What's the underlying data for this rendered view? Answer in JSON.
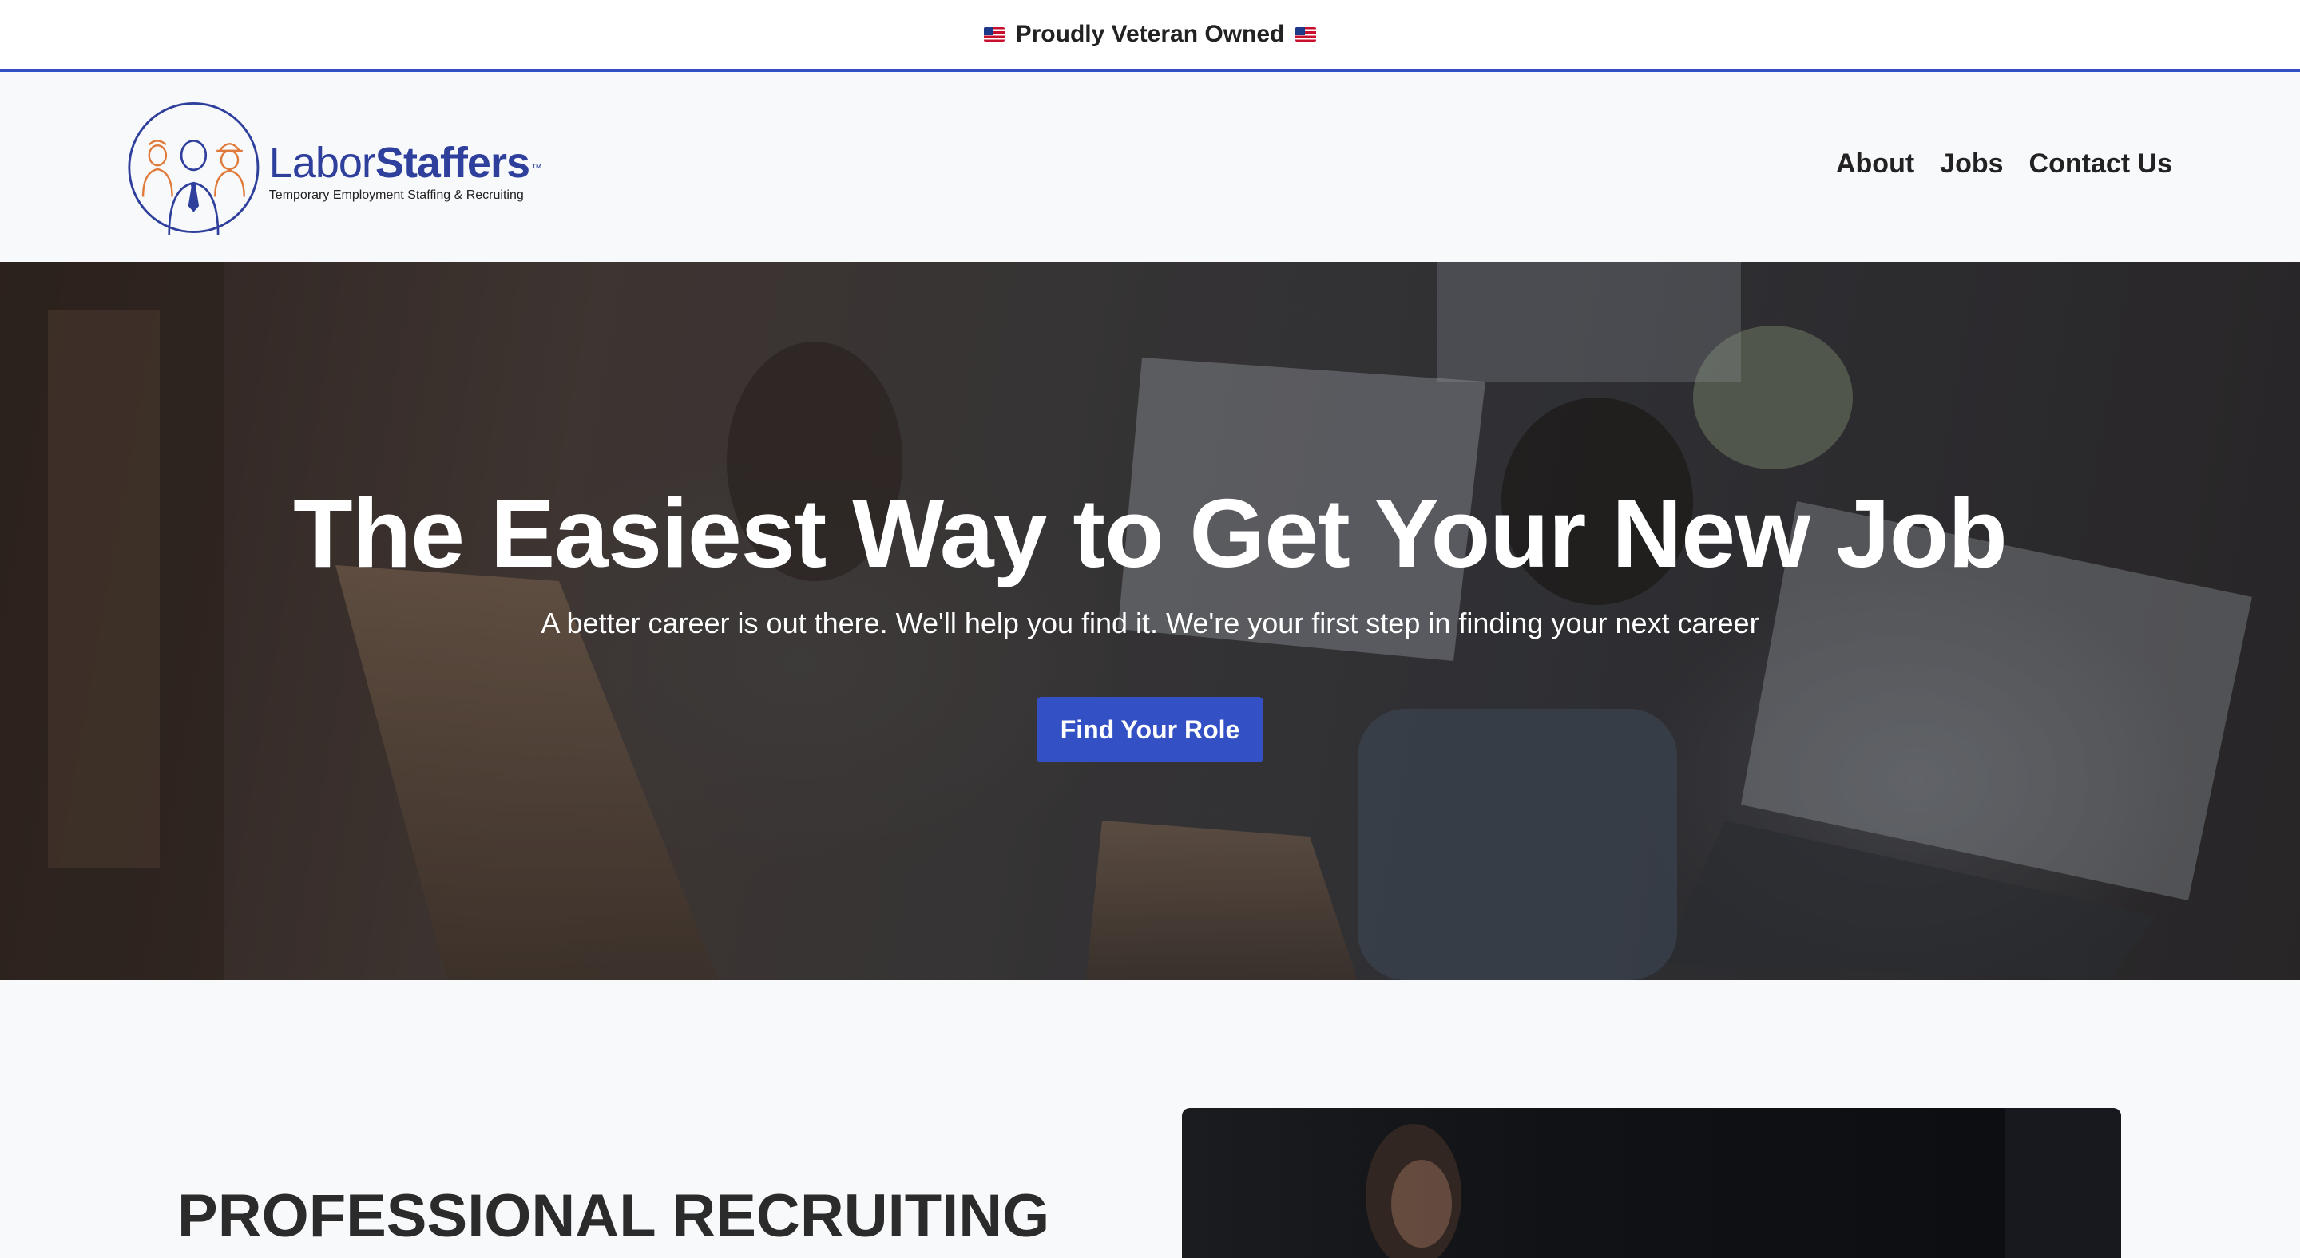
{
  "announcement": {
    "text": "Proudly Veteran Owned",
    "left_icon": "us-flag-icon",
    "right_icon": "us-flag-icon"
  },
  "header": {
    "brand": {
      "word1": "Labor",
      "word2": "Staffers",
      "trademark": "™",
      "tagline": "Temporary Employment Staffing & Recruiting"
    },
    "nav": [
      {
        "label": "About"
      },
      {
        "label": "Jobs"
      },
      {
        "label": "Contact Us"
      }
    ]
  },
  "hero": {
    "title": "The Easiest Way to Get Your New Job",
    "subtitle": "A better career is out there. We'll help you find it. We're your first step in finding your next career",
    "cta_label": "Find Your Role"
  },
  "section": {
    "title": "PROFESSIONAL RECRUITING"
  },
  "colors": {
    "accent": "#3350c4",
    "brand": "#2e3f9c",
    "logo_orange": "#e07a3a",
    "text": "#222222"
  }
}
